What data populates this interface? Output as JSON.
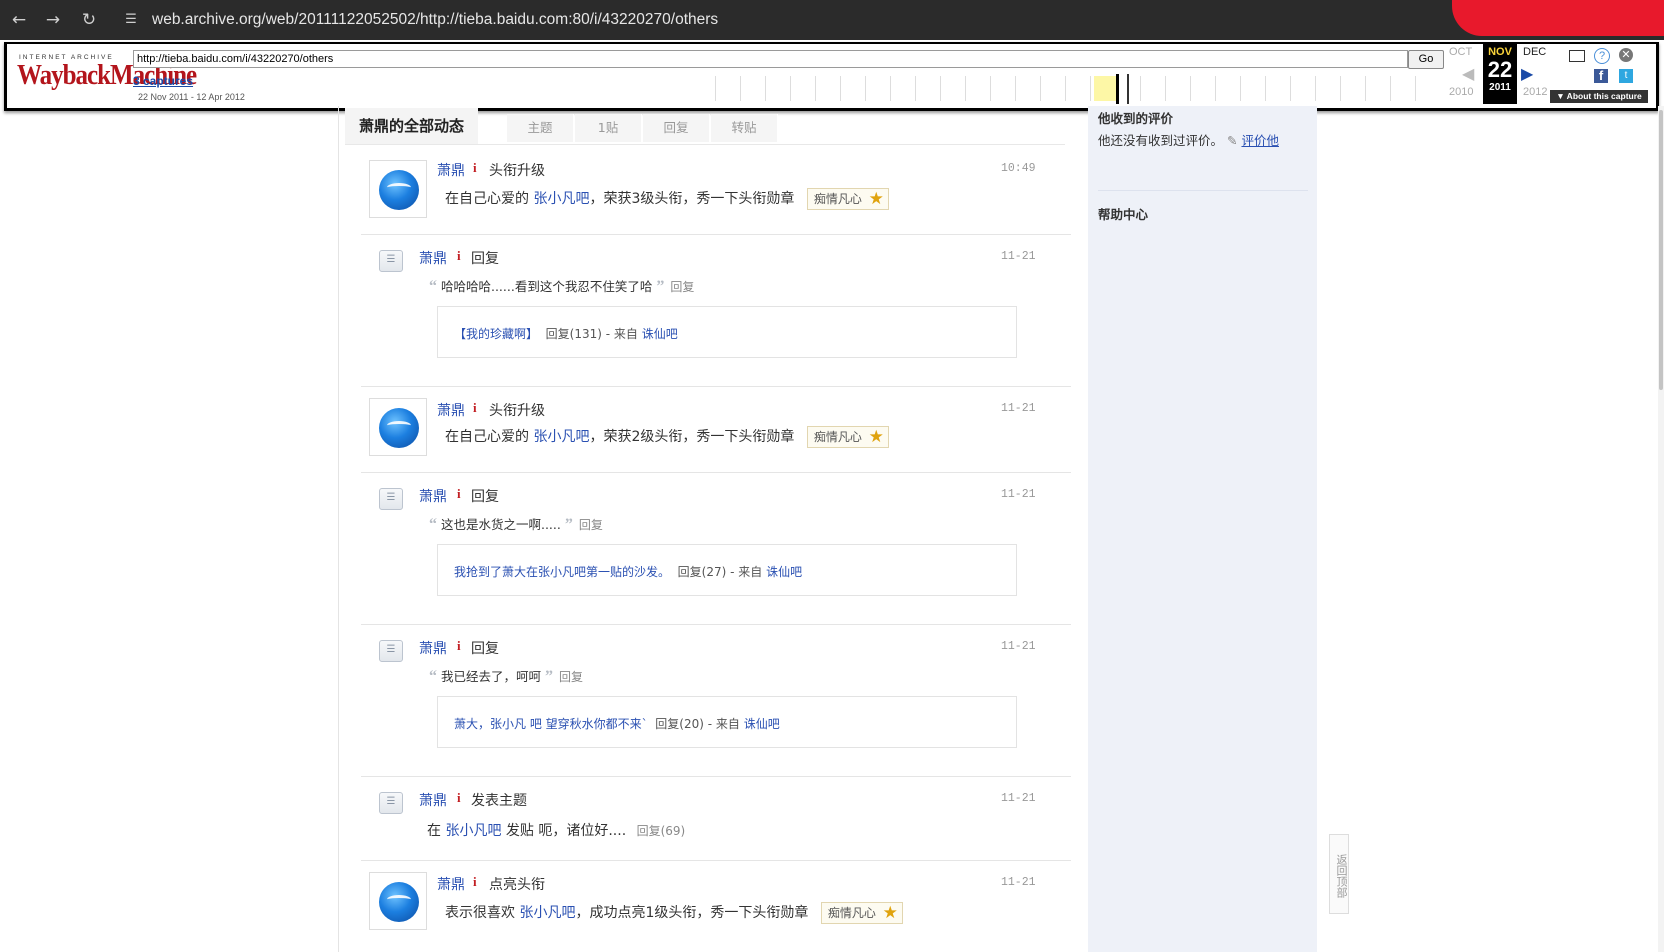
{
  "browser": {
    "address": "web.archive.org/web/20111122052502/http://tieba.baidu.com:80/i/43220270/others"
  },
  "wayback": {
    "logo_top": "INTERNET ARCHIVE",
    "logo": "WaybackMachine",
    "url_field": "http://tieba.baidu.com/i/43220270/others",
    "go_label": "Go",
    "captures": "3 captures",
    "range": "22 Nov 2011 - 12 Apr 2012",
    "prev_month": "OCT",
    "cur_month": "NOV",
    "next_month": "DEC",
    "prev_year": "2010",
    "cur_day": "22",
    "cur_year": "2011",
    "next_year": "2012",
    "about": "▼ About this capture"
  },
  "tabs": {
    "main": "萧鼎的全部动态",
    "items": [
      "主题",
      "1贴",
      "回复",
      "转贴"
    ]
  },
  "feed": [
    {
      "user": "萧鼎",
      "action": "头衔升级",
      "time": "10:49",
      "pre": "在自己心爱的 ",
      "bar": "张小凡吧",
      "post": "，荣获3级头衔，秀一下头衔勋章",
      "badge": "痴情凡心",
      "badge_num": "3"
    },
    {
      "user": "萧鼎",
      "action": "回复",
      "time": "11-21",
      "quote": "哈哈哈哈......看到这个我忍不住笑了哈",
      "reply": "回复",
      "src_title": "【我的珍藏啊】",
      "src_meta": "回复(131) -  来自 ",
      "src_bar": "诛仙吧"
    },
    {
      "user": "萧鼎",
      "action": "头衔升级",
      "time": "11-21",
      "pre": "在自己心爱的 ",
      "bar": "张小凡吧",
      "post": "，荣获2级头衔，秀一下头衔勋章",
      "badge": "痴情凡心",
      "badge_num": "2"
    },
    {
      "user": "萧鼎",
      "action": "回复",
      "time": "11-21",
      "quote": "这也是水货之一啊.....",
      "reply": "回复",
      "src_title": "我抢到了萧大在张小凡吧第一贴的沙发。",
      "src_meta": "回复(27) -  来自 ",
      "src_bar": "诛仙吧"
    },
    {
      "user": "萧鼎",
      "action": "回复",
      "time": "11-21",
      "quote": "我已经去了，呵呵",
      "reply": "回复",
      "src_title": "萧大，张小凡 吧 望穿秋水你都不来`",
      "src_meta": "回复(20) -  来自 ",
      "src_bar": "诛仙吧"
    },
    {
      "user": "萧鼎",
      "action": "发表主题",
      "time": "11-21",
      "pre": "在 ",
      "bar": "张小凡吧",
      "post": " 发贴 呃，诸位好....",
      "reply": "回复(69)"
    },
    {
      "user": "萧鼎",
      "action": "点亮头衔",
      "time": "11-21",
      "pre": "表示很喜欢 ",
      "bar": "张小凡吧",
      "post": "，成功点亮1级头衔，秀一下头衔勋章",
      "badge": "痴情凡心",
      "badge_num": "1"
    }
  ],
  "sidebar": {
    "title": "他收到的评价",
    "text": "他还没有收到过评价。",
    "eval_link": "评价他",
    "help": "帮助中心"
  },
  "back_top": "返回顶部"
}
